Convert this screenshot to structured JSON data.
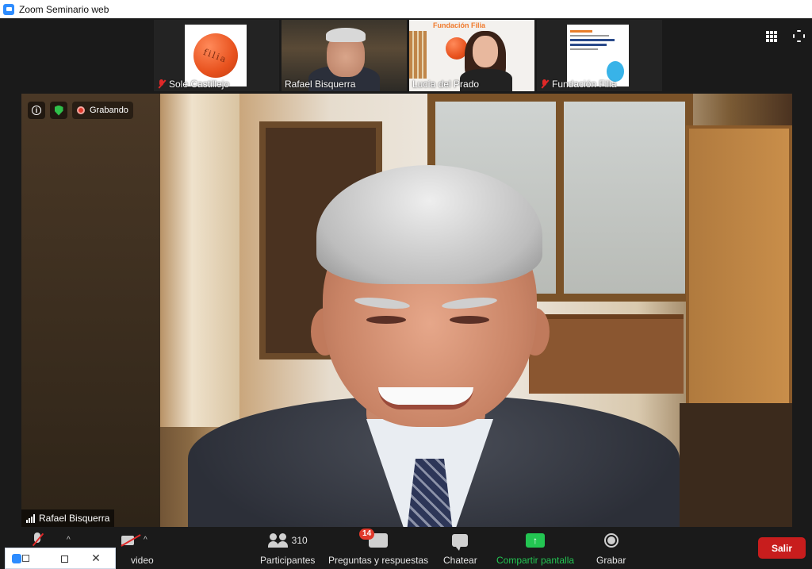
{
  "window": {
    "title": "Zoom Seminario web"
  },
  "thumbnails": [
    {
      "name": "Sole Castillejo",
      "muted": true,
      "ball_text": "filia"
    },
    {
      "name": "Rafael Bisquerra",
      "muted": false,
      "active": true
    },
    {
      "name": "Lucía del Prado",
      "muted": false,
      "brand": "Fundación Filia"
    },
    {
      "name": "Fundación Filia",
      "muted": true
    }
  ],
  "main": {
    "recording_label": "Grabando",
    "speaker_name": "Rafael Bisquerra"
  },
  "toolbar": {
    "video_label": "video",
    "participants_label": "Participantes",
    "participants_count": "310",
    "qa_label": "Preguntas y respuestas",
    "qa_badge": "14",
    "chat_label": "Chatear",
    "share_label": "Compartir pantalla",
    "record_label": "Grabar",
    "leave_label": "Salir"
  },
  "colors": {
    "share_accent": "#23c552",
    "leave_red": "#c81d1d",
    "active_outline": "#a6c93a",
    "badge_red": "#e0392b"
  },
  "icons": {
    "view": "grid-icon",
    "fullscreen": "fullscreen-icon"
  }
}
